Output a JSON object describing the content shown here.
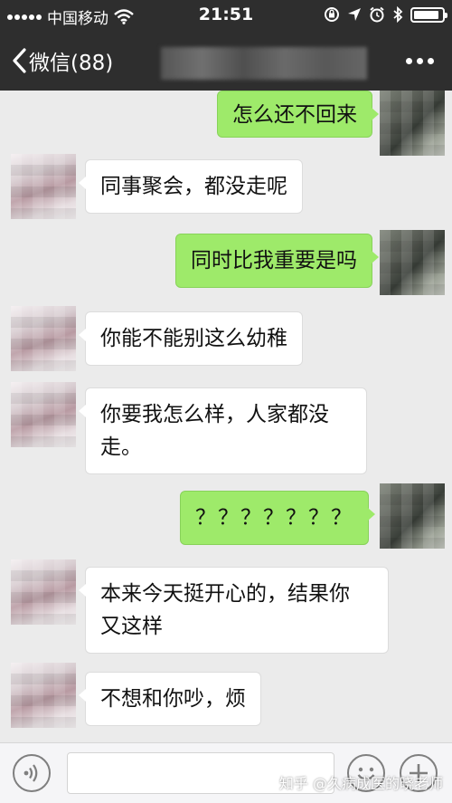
{
  "status_bar": {
    "carrier": "中国移动",
    "time": "21:51",
    "icons": [
      "signal-icon",
      "wifi-icon",
      "orientation-lock-icon",
      "location-icon",
      "alarm-icon",
      "bluetooth-icon",
      "battery-icon"
    ],
    "battery_level": 0.9
  },
  "nav": {
    "back_label": "微信(88)",
    "more_icon": "more-dots-icon"
  },
  "messages": [
    {
      "sender": "me",
      "text": "怎么还不回来"
    },
    {
      "sender": "friend",
      "text": "同事聚会，都没走呢"
    },
    {
      "sender": "me",
      "text": "同时比我重要是吗"
    },
    {
      "sender": "friend",
      "text": "你能不能别这么幼稚"
    },
    {
      "sender": "friend",
      "text": "你要我怎么样，人家都没\n走。"
    },
    {
      "sender": "me",
      "text": "？？？？？？？"
    },
    {
      "sender": "friend",
      "text": "本来今天挺开心的，结果你\n又这样"
    },
    {
      "sender": "friend",
      "text": "不想和你吵，烦"
    }
  ],
  "input_bar": {
    "value": "",
    "placeholder": "",
    "icons": [
      "voice-icon",
      "emoji-icon",
      "plus-icon"
    ]
  },
  "watermark": "知乎 @久病成医的晓老师",
  "colors": {
    "header_bg": "#2e2e2e",
    "chat_bg": "#ebebeb",
    "my_bubble": "#9eea6a",
    "friend_bubble": "#ffffff"
  }
}
